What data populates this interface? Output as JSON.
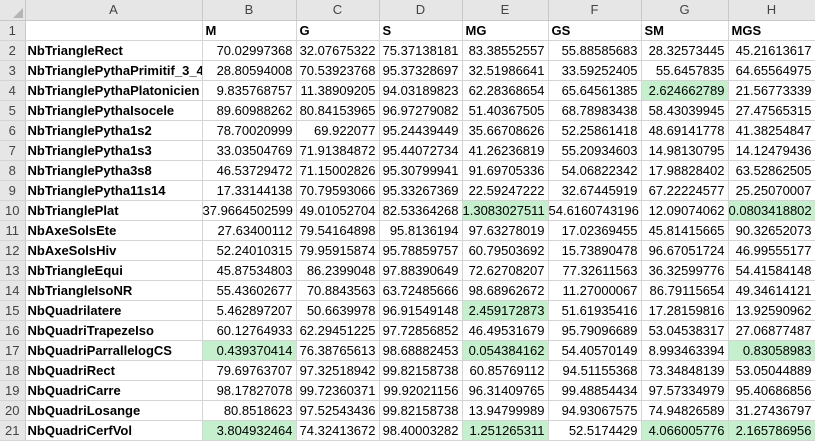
{
  "columns": [
    "A",
    "B",
    "C",
    "D",
    "E",
    "F",
    "G",
    "H"
  ],
  "header_row": {
    "number": "1",
    "cells": [
      "",
      "M",
      "G",
      "S",
      "MG",
      "GS",
      "SM",
      "MGS"
    ]
  },
  "highlight_color": "#c6efce",
  "rows": [
    {
      "number": "2",
      "name": "NbTriangleRect",
      "values": [
        "70.02997368",
        "32.07675322",
        "75.37138181",
        "83.38552557",
        "55.88585683",
        "28.32573445",
        "45.21613617"
      ],
      "hl": []
    },
    {
      "number": "3",
      "name": "NbTrianglePythaPrimitif_3_4",
      "values": [
        "28.80594008",
        "70.53923768",
        "95.37328697",
        "32.51986641",
        "33.59252405",
        "55.6457835",
        "64.65564975"
      ],
      "hl": []
    },
    {
      "number": "4",
      "name": "NbTrianglePythaPlatonicien",
      "values": [
        "9.835768757",
        "11.38909205",
        "94.03189823",
        "62.28368654",
        "65.64561385",
        "2.624662789",
        "21.56773339"
      ],
      "hl": [
        5
      ]
    },
    {
      "number": "5",
      "name": "NbTrianglePythaIsocele",
      "values": [
        "89.60988262",
        "80.84153965",
        "96.97279082",
        "51.40367505",
        "68.78983438",
        "58.43039945",
        "27.47565315"
      ],
      "hl": []
    },
    {
      "number": "6",
      "name": "NbTrianglePytha1s2",
      "values": [
        "78.70020999",
        "69.922077",
        "95.24439449",
        "35.66708626",
        "52.25861418",
        "48.69141778",
        "41.38254847"
      ],
      "hl": []
    },
    {
      "number": "7",
      "name": "NbTrianglePytha1s3",
      "values": [
        "33.03504769",
        "71.91384872",
        "95.44072734",
        "41.26236819",
        "55.20934603",
        "14.98130795",
        "14.12479436"
      ],
      "hl": []
    },
    {
      "number": "8",
      "name": "NbTrianglePytha3s8",
      "values": [
        "46.53729472",
        "71.15002826",
        "95.30799941",
        "91.69705336",
        "54.06822342",
        "17.98828402",
        "63.52862505"
      ],
      "hl": []
    },
    {
      "number": "9",
      "name": "NbTrianglePytha11s14",
      "values": [
        "17.33144138",
        "70.79593066",
        "95.33267369",
        "22.59247222",
        "32.67445919",
        "67.22224577",
        "25.25070007"
      ],
      "hl": []
    },
    {
      "number": "10",
      "name": "NbTrianglePlat",
      "values": [
        "37.9664502599",
        "49.01052704",
        "82.53364268",
        "1.3083027511",
        "54.6160743196",
        "12.09074062",
        "0.0803418802"
      ],
      "hl": [
        3,
        6
      ]
    },
    {
      "number": "11",
      "name": "NbAxeSolsEte",
      "values": [
        "27.63400112",
        "79.54164898",
        "95.8136194",
        "97.63278019",
        "17.02369455",
        "45.81415665",
        "90.32652073"
      ],
      "hl": []
    },
    {
      "number": "12",
      "name": "NbAxeSolsHiv",
      "values": [
        "52.24010315",
        "79.95915874",
        "95.78859757",
        "60.79503692",
        "15.73890478",
        "96.67051724",
        "46.99555177"
      ],
      "hl": []
    },
    {
      "number": "13",
      "name": "NbTriangleEqui",
      "values": [
        "45.87534803",
        "86.2399048",
        "97.88390649",
        "72.62708207",
        "77.32611563",
        "36.32599776",
        "54.41584148"
      ],
      "hl": []
    },
    {
      "number": "14",
      "name": "NbTriangleIsoNR",
      "values": [
        "55.43602677",
        "70.8843563",
        "63.72485666",
        "98.68962672",
        "11.27000067",
        "86.79115654",
        "49.34614121"
      ],
      "hl": []
    },
    {
      "number": "15",
      "name": "NbQuadrilatere",
      "values": [
        "5.462897207",
        "50.6639978",
        "96.91549148",
        "2.459172873",
        "51.61935416",
        "17.28159816",
        "13.92590962"
      ],
      "hl": [
        3
      ]
    },
    {
      "number": "16",
      "name": "NbQuadriTrapezeIso",
      "values": [
        "60.12764933",
        "62.29451225",
        "97.72856852",
        "46.49531679",
        "95.79096689",
        "53.04538317",
        "27.06877487"
      ],
      "hl": []
    },
    {
      "number": "17",
      "name": "NbQuadriParrallelogCS",
      "values": [
        "0.439370414",
        "76.38765613",
        "98.68882453",
        "0.054384162",
        "54.40570149",
        "8.993463394",
        "0.83058983"
      ],
      "hl": [
        0,
        3,
        6
      ]
    },
    {
      "number": "18",
      "name": "NbQuadriRect",
      "values": [
        "79.69763707",
        "97.32518942",
        "99.82158738",
        "60.85769112",
        "94.51155368",
        "73.34848139",
        "53.05044889"
      ],
      "hl": []
    },
    {
      "number": "19",
      "name": "NbQuadriCarre",
      "values": [
        "98.17827078",
        "99.72360371",
        "99.92021156",
        "96.31409765",
        "99.48854434",
        "97.57334979",
        "95.40686856"
      ],
      "hl": []
    },
    {
      "number": "20",
      "name": "NbQuadriLosange",
      "values": [
        "80.8518623",
        "97.52543436",
        "99.82158738",
        "13.94799989",
        "94.93067575",
        "74.94826589",
        "31.27436797"
      ],
      "hl": []
    },
    {
      "number": "21",
      "name": "NbQuadriCerfVol",
      "values": [
        "3.804932464",
        "74.32413672",
        "98.40003282",
        "1.251265311",
        "52.5174429",
        "4.066005776",
        "2.165786956"
      ],
      "hl": [
        0,
        3,
        5,
        6
      ]
    }
  ]
}
